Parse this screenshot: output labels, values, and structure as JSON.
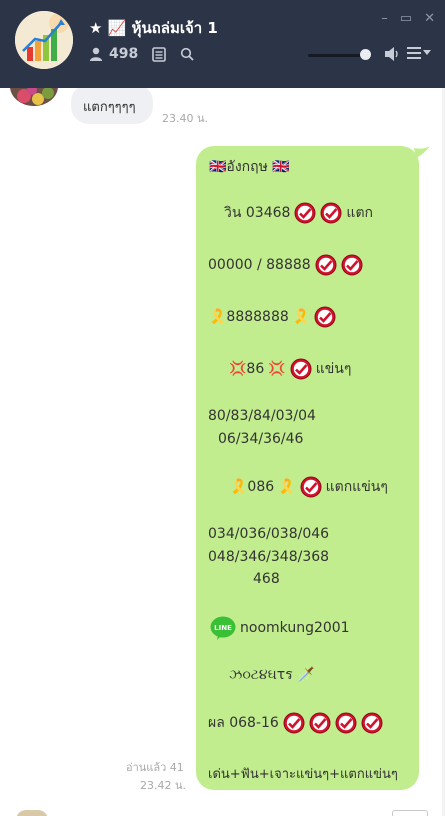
{
  "header": {
    "title": "★ 📈 หุ้นถล่มเจ้า 1",
    "member_count": "498",
    "window_controls": [
      "–",
      "▭",
      "✕"
    ]
  },
  "messages": {
    "incoming_text": "แตกๆๆๆๆ",
    "incoming_time": "23.40 น.",
    "read_label": "อ่านแล้ว 41",
    "outgoing_time": "23.42 น.",
    "lines": {
      "l1": "🇬🇧อังกฤษ 🇬🇧",
      "l2a": "วิน 03468",
      "l2b": "แตก",
      "l3": "00000 / 88888",
      "l4a": "🎗️8888888",
      "l4b": "🎗️",
      "l5a": "💢86",
      "l5b": "💢",
      "l5c": "แข่นๆ",
      "l6": "80/83/84/03/04",
      "l7": "06/34/36/46",
      "l8a": "🎗️086",
      "l8b": "🎗️",
      "l8c": "แตกแข่นๆ",
      "l9": "034/036/038/046",
      "l10": "048/346/348/368",
      "l11": "468",
      "l12": "noomkung2001",
      "l13": "ઝ૦ટ૪ઘτร 🗡️",
      "l14": "ผล 068-16",
      "l15": "เด่น+ฟัน+เจาะแข่นๆ+แตกแข่นๆ"
    }
  }
}
